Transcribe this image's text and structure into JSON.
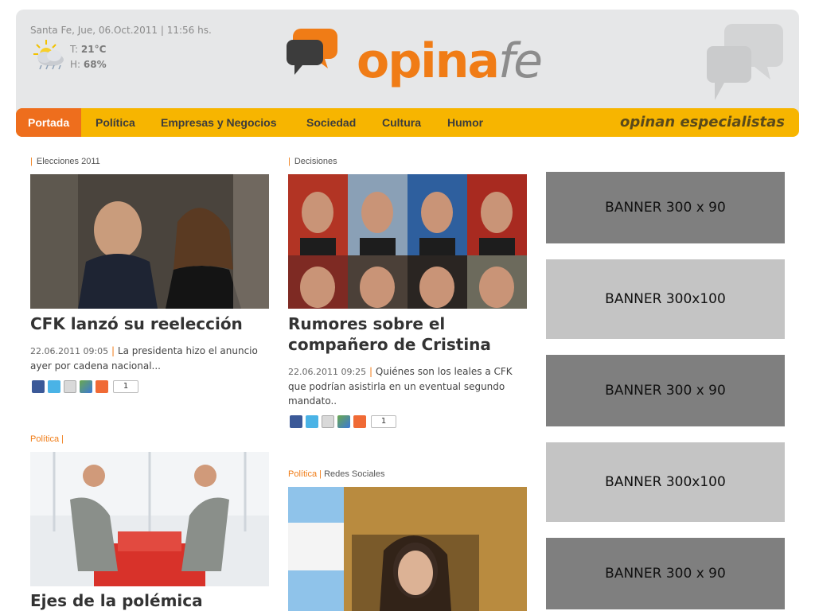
{
  "header": {
    "dateline": "Santa Fe, Jue, 06.Oct.2011 | 11:56 hs.",
    "temp_label": "T:",
    "temp_value": "21°C",
    "hum_label": "H:",
    "hum_value": "68%",
    "logo_part1": "opina",
    "logo_part2": "fe"
  },
  "nav": {
    "items": [
      "Portada",
      "Política",
      "Empresas y Negocios",
      "Sociedad",
      "Cultura",
      "Humor"
    ],
    "tagline": "opinan especialistas"
  },
  "articles": [
    {
      "tag": "Elecciones 2011",
      "title": "CFK lanzó su reelección",
      "timestamp": "22.06.2011 09:05",
      "summary": "La presidenta hizo el anuncio ayer por cadena nacional...",
      "count": "1"
    },
    {
      "tag": "Decisiones",
      "title": "Rumores sobre el compañero de Cristina",
      "timestamp": "22.06.2011 09:25",
      "summary": "Quiénes son los leales a CFK que podrían asistirla en un eventual segundo mandato..",
      "count": "1"
    },
    {
      "tag_cat": "Política",
      "tag_sep": "|",
      "title": "Ejes de la polémica"
    },
    {
      "tag_cat": "Política",
      "tag_sep": "|",
      "tag": "Redes Sociales"
    }
  ],
  "separator": "|",
  "banners": [
    "BANNER 300 x 90",
    "BANNER 300x100",
    "BANNER 300 x 90",
    "BANNER 300x100",
    "BANNER 300 x 90"
  ],
  "colors": {
    "accent_orange": "#f07c16",
    "nav_yellow": "#f7b500",
    "nav_active": "#ee6e1d"
  }
}
